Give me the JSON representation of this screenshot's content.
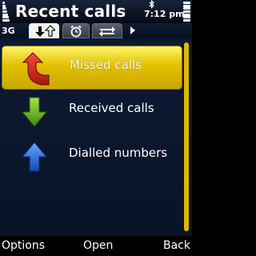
{
  "header": {
    "title": "Recent calls",
    "time": "7:12 pm",
    "network": "3G"
  },
  "tabs": [
    {
      "icon": "log-arrows-icon",
      "active": true
    },
    {
      "icon": "clock-icon",
      "active": false
    },
    {
      "icon": "transfer-arrows-icon",
      "active": false
    }
  ],
  "list": {
    "items": [
      {
        "label": "Missed calls",
        "icon": "missed-call-arrow-icon",
        "selected": true
      },
      {
        "label": "Received calls",
        "icon": "received-call-arrow-icon",
        "selected": false
      },
      {
        "label": "Dialled numbers",
        "icon": "dialled-call-arrow-icon",
        "selected": false
      }
    ]
  },
  "softkeys": {
    "left": "Options",
    "middle": "Open",
    "right": "Back"
  },
  "colors": {
    "selection": "#e2c100",
    "missed": "#d9261c",
    "received": "#6ab51e",
    "dialled": "#2b6fe0"
  }
}
